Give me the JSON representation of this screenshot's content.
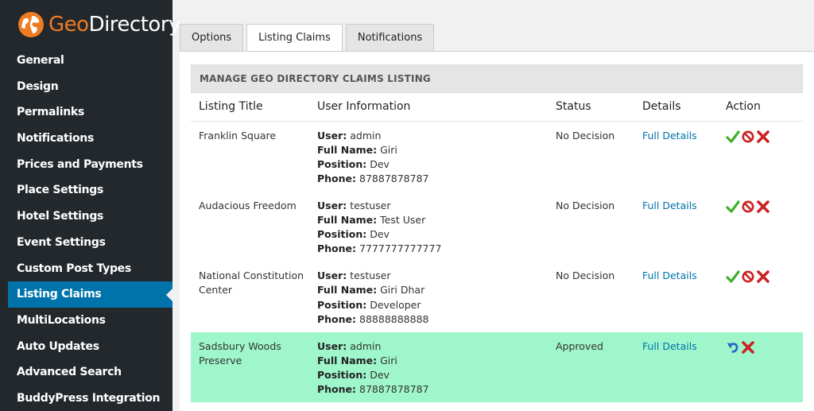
{
  "brand": {
    "geo": "Geo",
    "directory": "Directory"
  },
  "sidebar": {
    "items": [
      {
        "label": "General"
      },
      {
        "label": "Design"
      },
      {
        "label": "Permalinks"
      },
      {
        "label": "Notifications"
      },
      {
        "label": "Prices and Payments"
      },
      {
        "label": "Place Settings"
      },
      {
        "label": "Hotel Settings"
      },
      {
        "label": "Event Settings"
      },
      {
        "label": "Custom Post Types"
      },
      {
        "label": "Listing Claims",
        "active": true
      },
      {
        "label": "MultiLocations"
      },
      {
        "label": "Auto Updates"
      },
      {
        "label": "Advanced Search"
      },
      {
        "label": "BuddyPress Integration"
      }
    ]
  },
  "tabs": [
    {
      "label": "Options"
    },
    {
      "label": "Listing Claims",
      "active": true
    },
    {
      "label": "Notifications"
    }
  ],
  "panel": {
    "heading": "MANAGE GEO DIRECTORY CLAIMS LISTING",
    "columns": [
      "Listing Title",
      "User Information",
      "Status",
      "Details",
      "Action"
    ],
    "field_labels": {
      "user": "User:",
      "full_name": "Full Name:",
      "position": "Position:",
      "phone": "Phone:"
    },
    "rows": [
      {
        "title": "Franklin Square",
        "user": "admin",
        "full_name": "Giri",
        "position": "Dev",
        "phone": "87887878787",
        "status": "No Decision",
        "details": "Full Details"
      },
      {
        "title": "Audacious Freedom",
        "user": "testuser",
        "full_name": "Test User",
        "position": "Dev",
        "phone": "7777777777777",
        "status": "No Decision",
        "details": "Full Details"
      },
      {
        "title": "National Constitution Center",
        "user": "testuser",
        "full_name": "Giri Dhar",
        "position": "Developer",
        "phone": "88888888888",
        "status": "No Decision",
        "details": "Full Details"
      },
      {
        "title": "Sadsbury Woods Preserve",
        "user": "admin",
        "full_name": "Giri",
        "position": "Dev",
        "phone": "87887878787",
        "status": "Approved",
        "details": "Full Details"
      }
    ]
  },
  "icons": {
    "approve": "check-icon",
    "reject": "no-entry-icon",
    "delete": "cross-icon",
    "undo": "undo-icon"
  },
  "colors": {
    "sidebar_bg": "#23282d",
    "active_menu": "#0073aa",
    "brand_orange": "#ef7b22",
    "approved_row": "#9ff6cb",
    "link": "#0073aa"
  }
}
